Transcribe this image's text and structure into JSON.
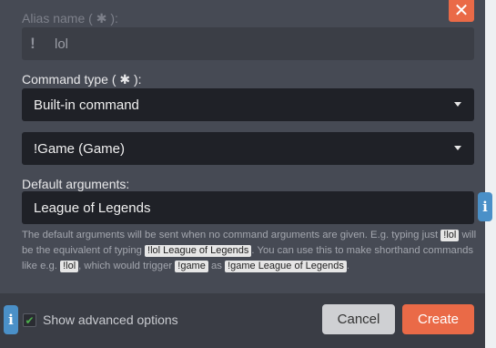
{
  "dialog": {
    "close_label": "✕"
  },
  "alias": {
    "label": "Alias name ( ✱ ):",
    "icon": "exclamation-icon",
    "value": "lol"
  },
  "command_type": {
    "label": "Command type ( ✱ ):",
    "value": "Built-in command"
  },
  "command": {
    "value": "!Game (Game)"
  },
  "default_arguments": {
    "label": "Default arguments:",
    "value": "League of Legends"
  },
  "help": {
    "t1": "The default arguments will be sent when no command arguments are given. E.g. typing just ",
    "c1": "!lol",
    "t2": " will be the equivalent of typing ",
    "c2": "!lol League of Legends",
    "t3": ". You can use this to make shorthand commands like e.g. ",
    "c3": "!lol",
    "t4": ", which would trigger ",
    "c4": "!game",
    "t5": " as ",
    "c5": "!game League of Legends",
    "t6": "."
  },
  "footer": {
    "show_advanced_label": "Show advanced options",
    "show_advanced_checked": true,
    "cancel_label": "Cancel",
    "create_label": "Create"
  },
  "colors": {
    "accent": "#ea6a47",
    "info": "#4a90c8",
    "panel": "#464a54"
  }
}
